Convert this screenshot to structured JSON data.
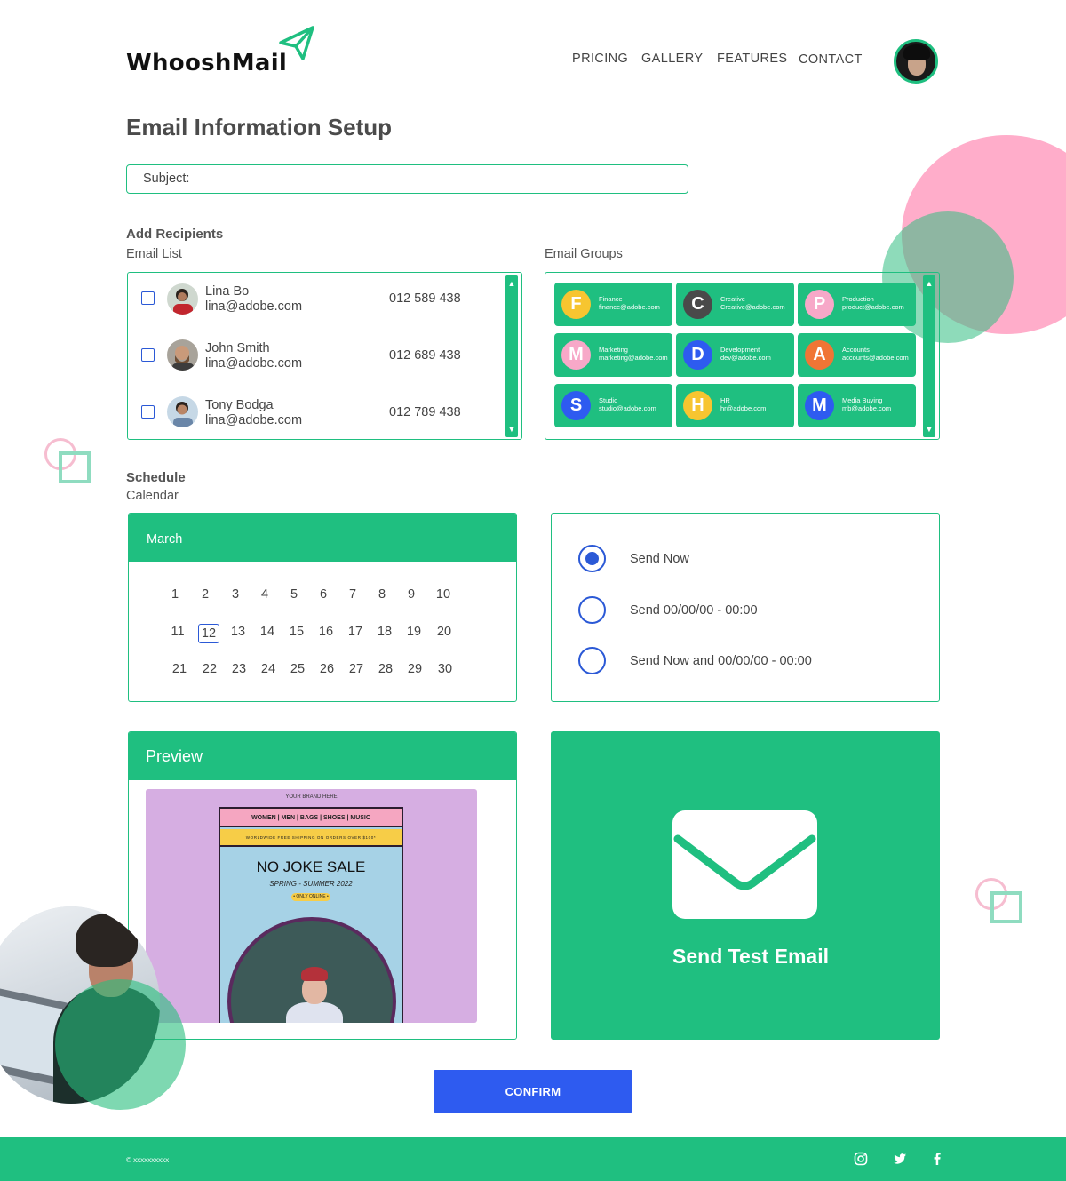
{
  "brand": {
    "name": "WhooshMail"
  },
  "nav": {
    "pricing": "PRICING",
    "gallery": "GALLERY",
    "features": "FEATURES",
    "contact": "CONTACT"
  },
  "page": {
    "title": "Email Information Setup"
  },
  "subject": {
    "label": "Subject:",
    "value": ""
  },
  "recipients": {
    "heading": "Add Recipients",
    "list_label": "Email List",
    "groups_label": "Email Groups",
    "people": [
      {
        "name": "Lina Bo",
        "email": "lina@adobe.com",
        "phone": "012 589 438"
      },
      {
        "name": "John Smith",
        "email": "lina@adobe.com",
        "phone": "012 689 438"
      },
      {
        "name": "Tony Bodga",
        "email": "lina@adobe.com",
        "phone": "012 789 438"
      }
    ],
    "groups": [
      {
        "letter": "F",
        "name": "Finance",
        "email": "finance@adobe.com",
        "color": "#f7c530"
      },
      {
        "letter": "C",
        "name": "Creative",
        "email": "Creative@adobe.com",
        "color": "#4a4a4a"
      },
      {
        "letter": "P",
        "name": "Production",
        "email": "product@adobe.com",
        "color": "#f7a8c8"
      },
      {
        "letter": "M",
        "name": "Marketing",
        "email": "marketing@adobe.com",
        "color": "#f7a8c8"
      },
      {
        "letter": "D",
        "name": "Development",
        "email": "dev@adobe.com",
        "color": "#2e5bf0"
      },
      {
        "letter": "A",
        "name": "Accounts",
        "email": "accounts@adobe.com",
        "color": "#f07535"
      },
      {
        "letter": "S",
        "name": "Studio",
        "email": "studio@adobe.com",
        "color": "#2e5bf0"
      },
      {
        "letter": "H",
        "name": "HR",
        "email": "hr@adobe.com",
        "color": "#f7c530"
      },
      {
        "letter": "M",
        "name": "Media Buying",
        "email": "mb@adobe.com",
        "color": "#2e5bf0"
      }
    ]
  },
  "schedule": {
    "heading": "Schedule",
    "calendar_label": "Calendar",
    "month": "March",
    "days": [
      "1",
      "2",
      "3",
      "4",
      "5",
      "6",
      "7",
      "8",
      "9",
      "10",
      "11",
      "12",
      "13",
      "14",
      "15",
      "16",
      "17",
      "18",
      "19",
      "20",
      "21",
      "22",
      "23",
      "24",
      "25",
      "26",
      "27",
      "28",
      "29",
      "30"
    ],
    "selected_day": "12",
    "options": [
      {
        "label": "Send Now",
        "selected": true
      },
      {
        "label": "Send 00/00/00 - 00:00",
        "selected": false
      },
      {
        "label": "Send Now and 00/00/00 - 00:00",
        "selected": false
      }
    ]
  },
  "preview": {
    "title": "Preview",
    "brand": "YOUR BRAND HERE",
    "nav": "WOMEN | MEN | BAGS | SHOES | MUSIC",
    "shipping": "WORLDWIDE FREE SHIPPING ON ORDERS OVER $100*",
    "sale": "NO JOKE SALE",
    "season": "SPRING - SUMMER 2022",
    "badge": "• ONLY ONLINE •"
  },
  "sendtest": {
    "label": "Send Test Email"
  },
  "confirm": {
    "label": "CONFIRM"
  },
  "footer": {
    "copyright": "© xxxxxxxxxx",
    "icons": [
      "instagram-icon",
      "twitter-icon",
      "facebook-icon"
    ]
  },
  "colors": {
    "primary": "#1fbf80",
    "accent": "#2e5bf0",
    "pink": "#ffadca"
  }
}
